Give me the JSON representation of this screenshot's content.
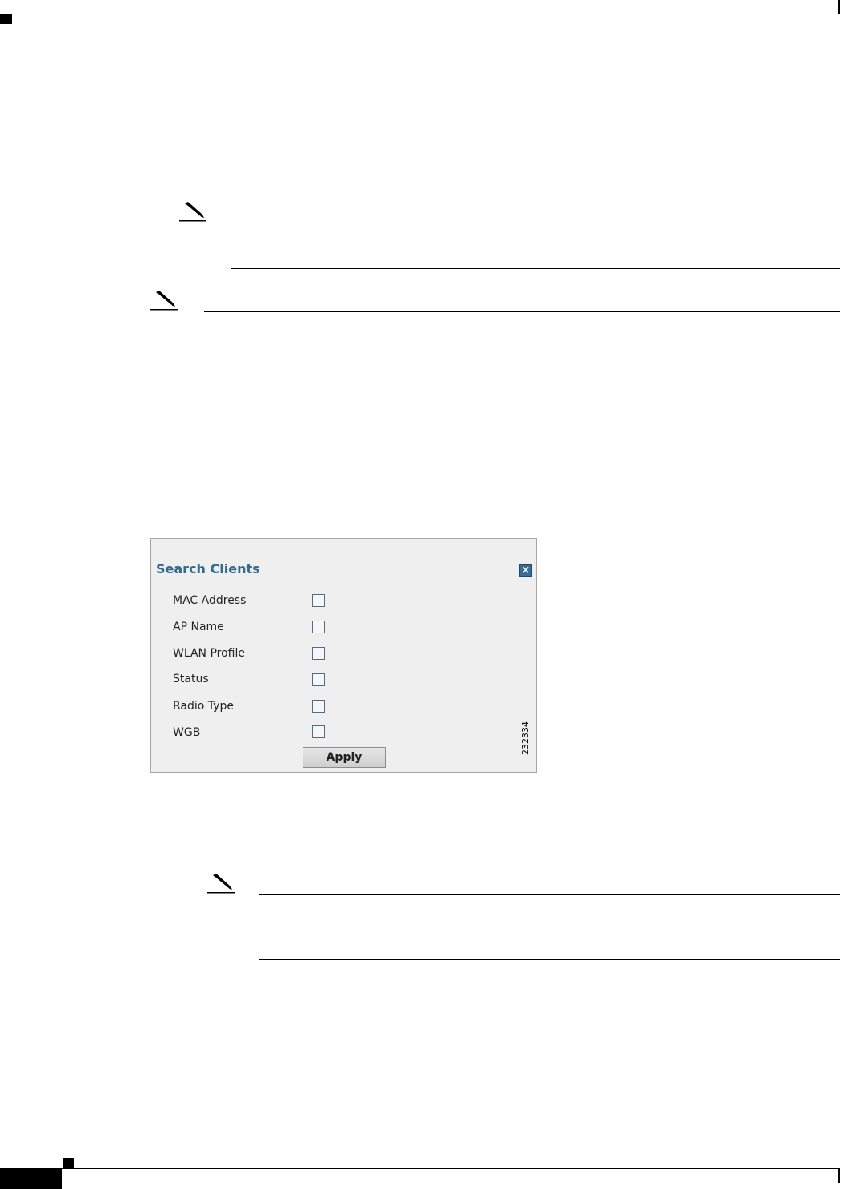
{
  "panel": {
    "title": "Search Clients",
    "close_symbol": "×",
    "fields": [
      {
        "label": "MAC Address",
        "checked": false
      },
      {
        "label": "AP Name",
        "checked": false
      },
      {
        "label": "WLAN Profile",
        "checked": false
      },
      {
        "label": "Status",
        "checked": false
      },
      {
        "label": "Radio Type",
        "checked": false
      },
      {
        "label": "WGB",
        "checked": false
      }
    ],
    "apply_label": "Apply"
  },
  "figure_id": "232334",
  "icons": {
    "note": "pencil-note-icon",
    "close": "close-icon",
    "checkbox": "checkbox-icon"
  },
  "colors": {
    "panel_title": "#336b8d",
    "close_button": "#3b6d94",
    "panel_background": "#efefef"
  }
}
